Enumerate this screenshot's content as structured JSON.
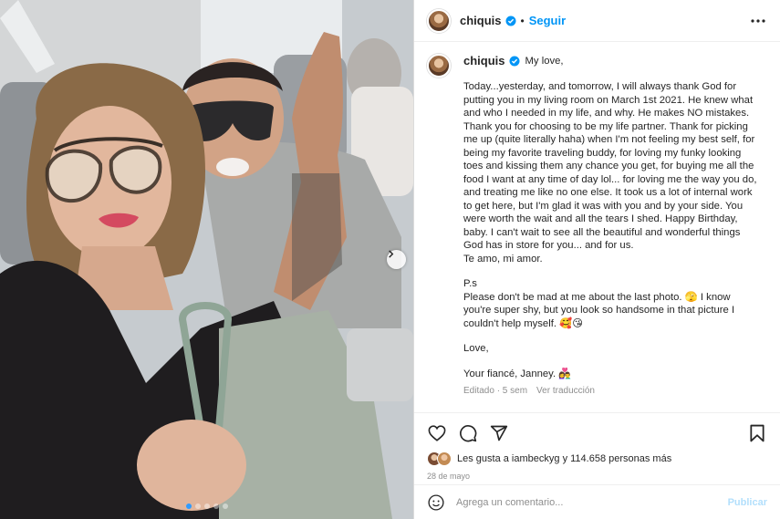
{
  "post": {
    "username": "chiquis",
    "verified_icon": "verified-badge-icon",
    "separator": "•",
    "follow_label": "Seguir",
    "more_icon": "more-options-icon",
    "accent_color": "#0095f6"
  },
  "caption": {
    "greeting": "My love,",
    "body": "Today...yesterday, and tomorrow, I will always thank God for putting you in my living room on March 1st 2021. He knew what and who I needed in my life, and why. He makes NO mistakes. Thank you for choosing to be my life partner. Thank for picking me up (quite literally haha) when I'm not feeling my best self, for being my favorite traveling buddy, for loving my funky looking toes and kissing them any chance you get, for buying me all the food I want at any time of day lol... for loving me the way you do, and treating me like no one else. It took us a lot of internal work to get here, but I'm glad it was with you and by your side. You were worth the wait and all the tears I shed. Happy Birthday, baby. I can't wait to see all the beautiful and wonderful things God has in store for you... and for us.\nTe amo, mi amor.",
    "ps": "P.s\nPlease don't be mad at me about the last photo. 🫣 I know you're super shy, but you look so handsome in that picture I couldn't help myself. 🥰😘",
    "sign_love": "Love,",
    "sign_name": "Your fiancé, Janney. 👩‍❤️‍👨",
    "edited": "Editado · 5 sem",
    "translate": "Ver traducción"
  },
  "actions": {
    "like_icon": "heart-icon",
    "comment_icon": "comment-icon",
    "share_icon": "share-icon",
    "save_icon": "bookmark-icon"
  },
  "likes": {
    "text": "Les gusta a iambeckyg y 114.658 personas más"
  },
  "date": "28 de mayo",
  "comment": {
    "emoji_icon": "emoji-icon",
    "placeholder": "Agrega un comentario...",
    "publish_label": "Publicar"
  },
  "carousel": {
    "next_icon": "chevron-right-icon",
    "slides": 5,
    "active": 1
  }
}
